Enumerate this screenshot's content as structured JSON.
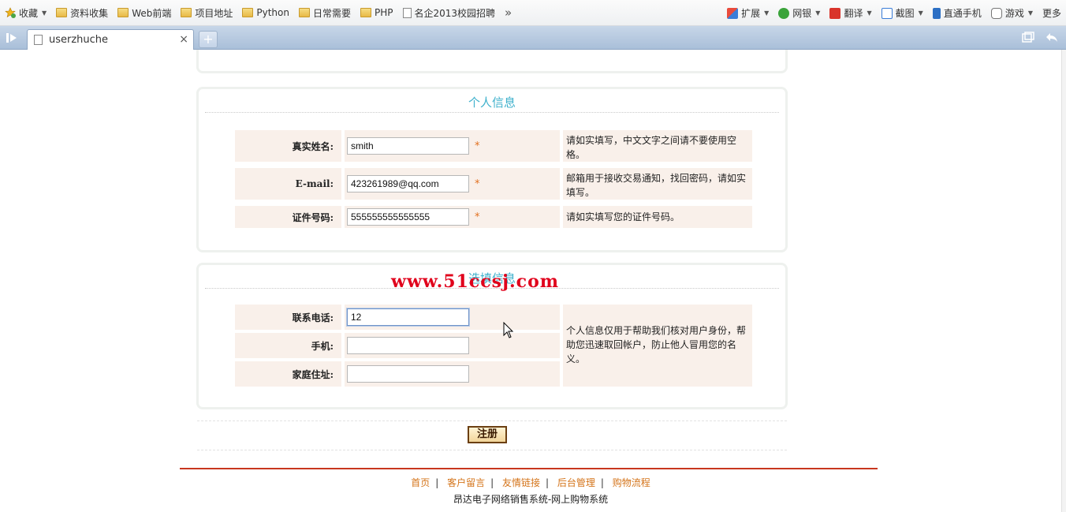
{
  "bookmarks": {
    "items": [
      "收藏",
      "资料收集",
      "Web前端",
      "项目地址",
      "Python",
      "日常需要",
      "PHP",
      "名企2013校园招聘"
    ],
    "more_chevron": "»",
    "right": [
      "扩展",
      "网银",
      "翻译",
      "截图",
      "直通手机",
      "游戏",
      "更多"
    ]
  },
  "tabs": {
    "active_title": "userzhuche",
    "close_glyph": "×",
    "new_tab_glyph": "+"
  },
  "section_personal": {
    "title": "个人信息",
    "fields": [
      {
        "label": "真实姓名:",
        "value": "smith",
        "required": "*",
        "note": "请如实填写，中文文字之间请不要使用空格。"
      },
      {
        "label": "E-mail:",
        "value": "423261989@qq.com",
        "required": "*",
        "note": "邮箱用于接收交易通知，找回密码，请如实填写。"
      },
      {
        "label": "证件号码:",
        "value": "555555555555555",
        "required": "*",
        "note": "请如实填写您的证件号码。"
      }
    ]
  },
  "section_optional": {
    "title": "选填信息",
    "fields": [
      {
        "label": "联系电话:",
        "value": "12"
      },
      {
        "label": "手机:",
        "value": ""
      },
      {
        "label": "家庭住址:",
        "value": ""
      }
    ],
    "note": "个人信息仅用于帮助我们核对用户身份，帮助您迅速取回帐户，防止他人冒用您的名义。"
  },
  "watermark": "www.51ccsj.com",
  "register_button": "注册",
  "footer": {
    "links": [
      "首页",
      "客户留言",
      "友情链接",
      "后台管理",
      "购物流程"
    ],
    "separator": "|",
    "copyright": "昂达电子网络销售系统-网上购物系统"
  },
  "colors": {
    "section_title": "#3fb1cc",
    "required_star": "#e2701f",
    "row_bg": "#f9f0ea",
    "watermark": "#e0001b",
    "footer_link": "#d4741a",
    "footer_line": "#c8371f"
  }
}
